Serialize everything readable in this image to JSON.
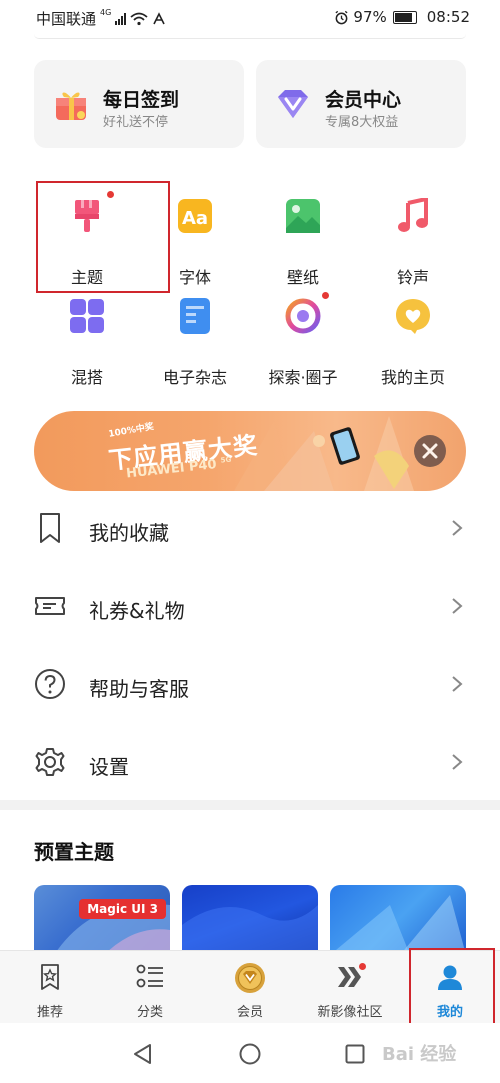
{
  "status_bar": {
    "carrier": "中国联通",
    "network": "4G",
    "battery": "97%",
    "time": "08:52"
  },
  "top_cards": [
    {
      "title": "每日签到",
      "subtitle": "好礼送不停",
      "icon": "gift-icon"
    },
    {
      "title": "会员中心",
      "subtitle": "专属8大权益",
      "icon": "vip-diamond-icon"
    }
  ],
  "grid": [
    {
      "label": "主题",
      "icon": "theme-brush-icon",
      "badge": true
    },
    {
      "label": "字体",
      "icon": "font-icon",
      "badge": false
    },
    {
      "label": "壁纸",
      "icon": "wallpaper-icon",
      "badge": false
    },
    {
      "label": "铃声",
      "icon": "ringtone-music-icon",
      "badge": false
    },
    {
      "label": "混搭",
      "icon": "mix-grid-icon",
      "badge": false
    },
    {
      "label": "电子杂志",
      "icon": "magazine-icon",
      "badge": false
    },
    {
      "label": "探索·圈子",
      "icon": "explore-circle-icon",
      "badge": true
    },
    {
      "label": "我的主页",
      "icon": "homepage-heart-icon",
      "badge": false
    }
  ],
  "banner": {
    "tag": "100%中奖",
    "headline": "下应用赢大奖",
    "product": "HUAWEI P40",
    "product_suffix": "5G"
  },
  "menu": [
    {
      "label": "我的收藏",
      "icon": "bookmark-icon"
    },
    {
      "label": "礼券&礼物",
      "icon": "coupon-icon"
    },
    {
      "label": "帮助与客服",
      "icon": "help-icon"
    },
    {
      "label": "设置",
      "icon": "gear-icon"
    }
  ],
  "preset_section": {
    "title": "预置主题",
    "badge": "Magic UI 3"
  },
  "bottom_nav": [
    {
      "label": "推荐",
      "icon": "recommend-star-icon",
      "active": false
    },
    {
      "label": "分类",
      "icon": "category-list-icon",
      "active": false
    },
    {
      "label": "会员",
      "icon": "member-coin-icon",
      "active": false
    },
    {
      "label": "新影像社区",
      "icon": "community-chevron-icon",
      "active": false
    },
    {
      "label": "我的",
      "icon": "profile-person-icon",
      "active": true
    }
  ],
  "watermark": "Bai 经验",
  "colors": {
    "accent": "#1e88d8",
    "highlight_box": "#d0262d",
    "badge_red": "#e53935"
  }
}
